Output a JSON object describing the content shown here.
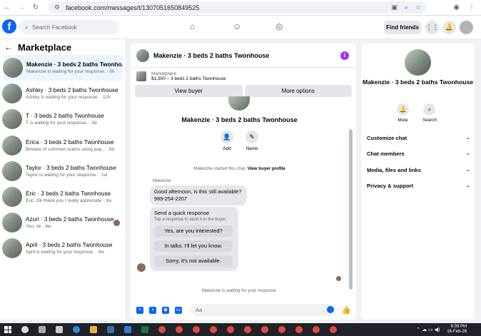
{
  "browser": {
    "url": "facebook.com/messages/t/1307051650849525"
  },
  "fb": {
    "search_placeholder": "Search Facebook",
    "find_friends": "Find friends"
  },
  "left": {
    "title": "Marketplace",
    "conversations": [
      {
        "name": "Makenzie · 3 beds 2 baths Twonho...",
        "sub": "Makenzie is waiting for your response. · 5h",
        "active": true
      },
      {
        "name": "Ashley · 3 beds 2 baths Twonhouse",
        "sub": "Ashley is waiting for your response. · 12h"
      },
      {
        "name": "T · 3 beds 2 baths Twonhouse",
        "sub": "T is waiting for your response. · 3d"
      },
      {
        "name": "Erica · 3 beds 2 baths Twonhouse",
        "sub": "Beware of common scams using pay... · 5d"
      },
      {
        "name": "Taylor · 3 beds 2 baths Twonhouse",
        "sub": "Taylor is waiting for your response. · 1w"
      },
      {
        "name": "Eric · 3 beds 2 baths Twonhouse",
        "sub": "Eric: Ok thank you I really appreciate · 3w"
      },
      {
        "name": "Azuri · 3 beds 2 baths Twonhouse",
        "sub": "You: ok · 4w"
      },
      {
        "name": "April · 3 beds 2 baths Twonhouse",
        "sub": "April is waiting for your response. · 4w"
      }
    ]
  },
  "chat": {
    "title": "Makenzie · 3 beds 2 baths Twonhouse",
    "listing_label": "Marketplace",
    "listing_detail": "$1,300 – 3 beds 2 baths Twonhouse",
    "view_buyer": "View buyer",
    "more_options": "More options",
    "profile_name": "Makenzie · 3 beds 2 baths Twonhouse",
    "add_label": "Add",
    "name_label": "Name",
    "started_text": "Makenzie started this chat.",
    "view_profile": "View buyer profile",
    "sender": "Makenzie",
    "message_line1": "Good afternoon, is this still available?",
    "message_line2": "989-254-2207",
    "quick_title": "Send a quick response",
    "quick_sub": "Tap a response to send it to the buyer.",
    "quick_replies": [
      "Yes, are you interested?",
      "In talks. I'll let you know.",
      "Sorry, it's not available."
    ],
    "waiting": "Makenzie is waiting for your response.",
    "composer_placeholder": "Aa"
  },
  "right": {
    "name": "Makenzie · 3 beds 2 baths Twonhouse",
    "mute": "Mute",
    "search": "Search",
    "sections": [
      "Customize chat",
      "Chat members",
      "Media, files and links",
      "Privacy & support"
    ]
  },
  "taskbar": {
    "time": "6:09 PM",
    "date": "16-Feb-26"
  },
  "colors": {
    "brand": "#0866ff",
    "active_row": "#ebf5ff",
    "bubble": "#e4e6eb",
    "info": "#a033ff"
  }
}
